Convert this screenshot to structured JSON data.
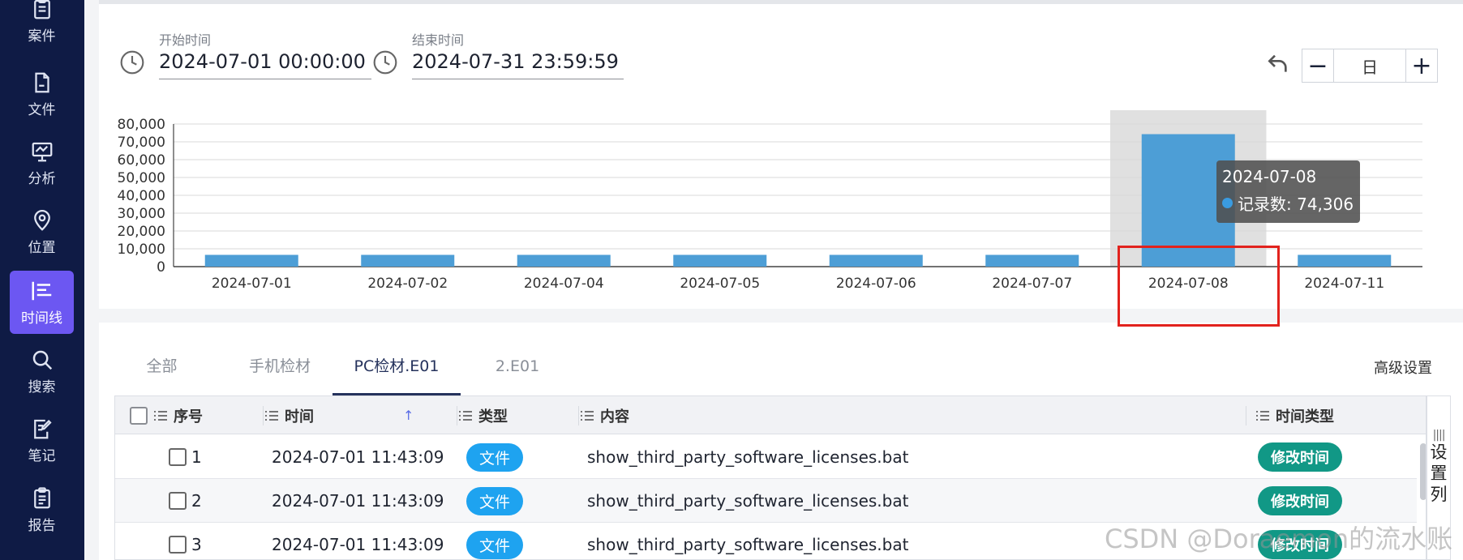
{
  "sidebar": {
    "items": [
      {
        "label": "案件",
        "icon": "clipboard-icon"
      },
      {
        "label": "文件",
        "icon": "file-icon"
      },
      {
        "label": "分析",
        "icon": "presentation-icon"
      },
      {
        "label": "位置",
        "icon": "location-pin-icon"
      },
      {
        "label": "时间线",
        "icon": "timeline-icon",
        "active": true
      },
      {
        "label": "搜索",
        "icon": "search-icon"
      },
      {
        "label": "笔记",
        "icon": "note-edit-icon"
      },
      {
        "label": "报告",
        "icon": "report-icon"
      }
    ]
  },
  "filters": {
    "start_label": "开始时间",
    "start_value": "2024-07-01 00:00:00",
    "end_label": "结束时间",
    "end_value": "2024-07-31 23:59:59"
  },
  "zoom": {
    "minus": "−",
    "unit": "日",
    "plus": "+"
  },
  "chart_data": {
    "type": "bar",
    "categories": [
      "2024-07-01",
      "2024-07-02",
      "2024-07-04",
      "2024-07-05",
      "2024-07-06",
      "2024-07-07",
      "2024-07-08",
      "2024-07-11"
    ],
    "series": [
      {
        "name": "记录数",
        "values": [
          6600,
          6600,
          6600,
          6600,
          6600,
          6600,
          74306,
          6600
        ]
      }
    ],
    "ylim": [
      0,
      80000
    ],
    "yticks": [
      "0",
      "10,000",
      "20,000",
      "30,000",
      "40,000",
      "50,000",
      "60,000",
      "70,000",
      "80,000"
    ],
    "highlight_index": 6,
    "bar_color": "#4d9ed6",
    "tooltip": {
      "date": "2024-07-08",
      "label": "记录数: 74,306"
    }
  },
  "tabs": [
    {
      "label": "全部"
    },
    {
      "label": "手机检材"
    },
    {
      "label": "PC检材.E01",
      "active": true
    },
    {
      "label": "2.E01"
    }
  ],
  "advanced_settings": "高级设置",
  "table": {
    "columns": {
      "index": "序号",
      "time": "时间",
      "sort": "↑",
      "type": "类型",
      "content": "内容",
      "time_type": "时间类型"
    },
    "rows": [
      {
        "index": "1",
        "time": "2024-07-01 11:43:09",
        "type": "文件",
        "content": "show_third_party_software_licenses.bat",
        "time_type": "修改时间"
      },
      {
        "index": "2",
        "time": "2024-07-01 11:43:09",
        "type": "文件",
        "content": "show_third_party_software_licenses.bat",
        "time_type": "修改时间"
      },
      {
        "index": "3",
        "time": "2024-07-01 11:43:09",
        "type": "文件",
        "content": "show_third_party_software_licenses.bat",
        "time_type": "修改时间"
      }
    ]
  },
  "column_settings": {
    "bars": "||||",
    "c1": "设",
    "c2": "置",
    "c3": "列"
  },
  "watermark": "CSDN @Doraemon的流水账"
}
